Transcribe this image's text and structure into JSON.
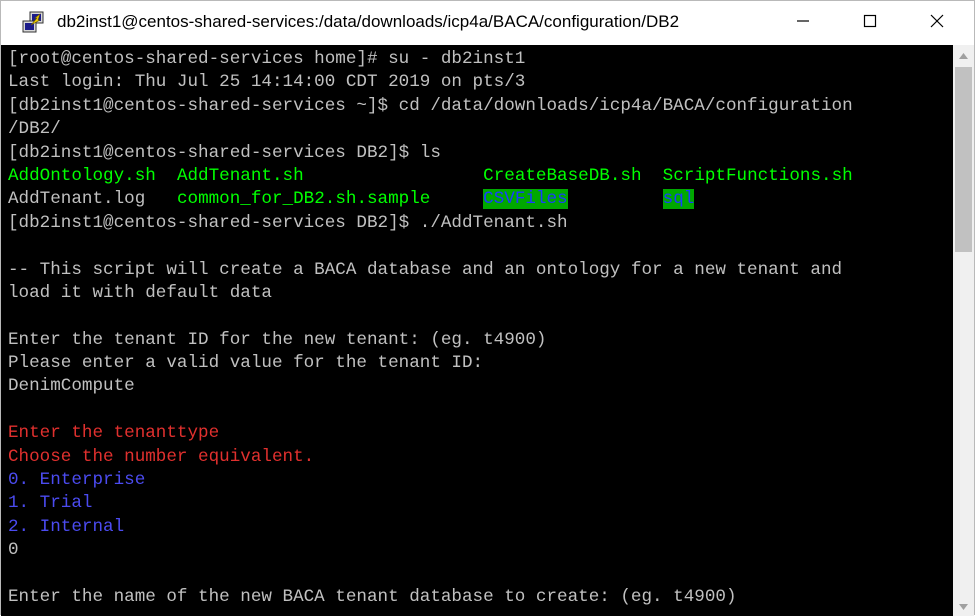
{
  "window": {
    "title": "db2inst1@centos-shared-services:/data/downloads/icp4a/BACA/configuration/DB2",
    "app_icon": "putty-icon",
    "controls": {
      "minimize": "minimize-icon",
      "maximize": "maximize-icon",
      "close": "close-icon"
    }
  },
  "colors": {
    "terminal_bg": "#000000",
    "text_default": "#c0c0c0",
    "text_executable": "#00ff00",
    "text_prompt_red": "#e0302e",
    "text_option_blue": "#4b4bf0",
    "dir_highlight_bg": "#00a800"
  },
  "terminal": {
    "lines": [
      {
        "segments": [
          {
            "text": "[root@centos-shared-services home]# su - db2inst1",
            "style": "default"
          }
        ]
      },
      {
        "segments": [
          {
            "text": "Last login: Thu Jul 25 14:14:00 CDT 2019 on pts/3",
            "style": "default"
          }
        ]
      },
      {
        "segments": [
          {
            "text": "[db2inst1@centos-shared-services ~]$ cd /data/downloads/icp4a/BACA/configuration",
            "style": "default"
          }
        ]
      },
      {
        "segments": [
          {
            "text": "/DB2/",
            "style": "default"
          }
        ]
      },
      {
        "segments": [
          {
            "text": "[db2inst1@centos-shared-services DB2]$ ls",
            "style": "default"
          }
        ]
      },
      {
        "segments": [
          {
            "text": "AddOntology.sh",
            "style": "green"
          },
          {
            "text": "  ",
            "style": "default"
          },
          {
            "text": "AddTenant.sh",
            "style": "green"
          },
          {
            "text": "                 ",
            "style": "default"
          },
          {
            "text": "CreateBaseDB.sh",
            "style": "green"
          },
          {
            "text": "  ",
            "style": "default"
          },
          {
            "text": "ScriptFunctions.sh",
            "style": "green"
          }
        ]
      },
      {
        "segments": [
          {
            "text": "AddTenant.log",
            "style": "default"
          },
          {
            "text": "   ",
            "style": "default"
          },
          {
            "text": "common_for_DB2.sh.sample",
            "style": "green"
          },
          {
            "text": "     ",
            "style": "default"
          },
          {
            "text": "CSVFiles",
            "style": "hl"
          },
          {
            "text": "         ",
            "style": "default"
          },
          {
            "text": "sql",
            "style": "hl"
          }
        ]
      },
      {
        "segments": [
          {
            "text": "[db2inst1@centos-shared-services DB2]$ ./AddTenant.sh",
            "style": "default"
          }
        ]
      },
      {
        "segments": [
          {
            "text": "",
            "style": "default"
          }
        ]
      },
      {
        "segments": [
          {
            "text": "-- This script will create a BACA database and an ontology for a new tenant and",
            "style": "default"
          }
        ]
      },
      {
        "segments": [
          {
            "text": "load it with default data",
            "style": "default"
          }
        ]
      },
      {
        "segments": [
          {
            "text": "",
            "style": "default"
          }
        ]
      },
      {
        "segments": [
          {
            "text": "Enter the tenant ID for the new tenant: (eg. t4900)",
            "style": "default"
          }
        ]
      },
      {
        "segments": [
          {
            "text": "Please enter a valid value for the tenant ID:",
            "style": "default"
          }
        ]
      },
      {
        "segments": [
          {
            "text": "DenimCompute",
            "style": "default"
          }
        ]
      },
      {
        "segments": [
          {
            "text": "",
            "style": "default"
          }
        ]
      },
      {
        "segments": [
          {
            "text": "Enter the tenanttype",
            "style": "red"
          }
        ]
      },
      {
        "segments": [
          {
            "text": "Choose the number equivalent.",
            "style": "red"
          }
        ]
      },
      {
        "segments": [
          {
            "text": "0. Enterprise",
            "style": "blue"
          }
        ]
      },
      {
        "segments": [
          {
            "text": "1. Trial",
            "style": "blue"
          }
        ]
      },
      {
        "segments": [
          {
            "text": "2. Internal",
            "style": "blue"
          }
        ]
      },
      {
        "segments": [
          {
            "text": "0",
            "style": "default"
          }
        ]
      },
      {
        "segments": [
          {
            "text": "",
            "style": "default"
          }
        ]
      },
      {
        "segments": [
          {
            "text": "Enter the name of the new BACA tenant database to create: (eg. t4900)",
            "style": "default"
          }
        ]
      }
    ]
  }
}
